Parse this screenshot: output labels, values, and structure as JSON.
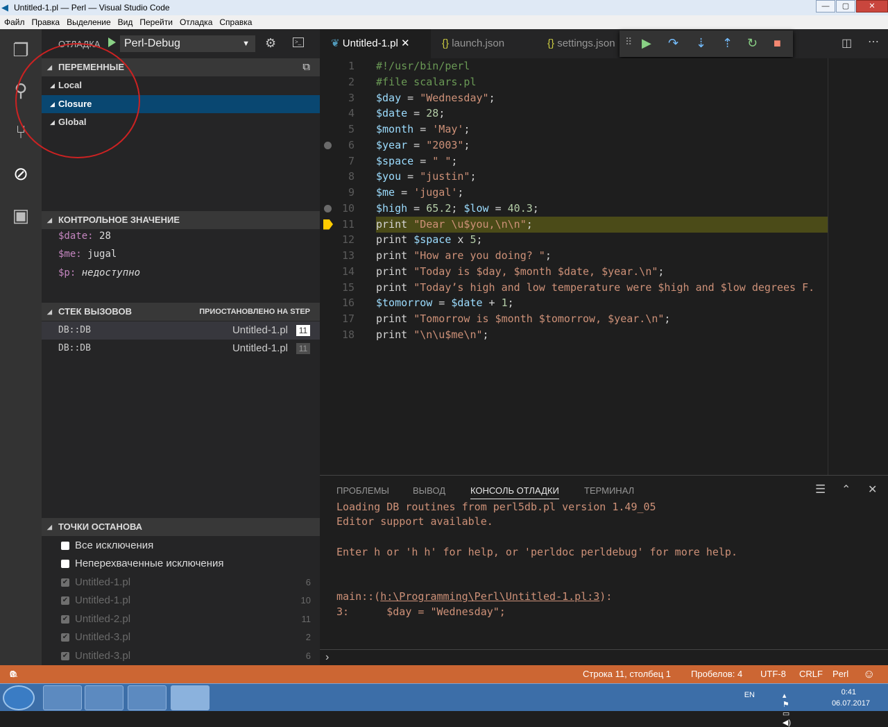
{
  "window": {
    "title": "Untitled-1.pl — Perl — Visual Studio Code",
    "min": "—",
    "max": "▢",
    "close": "✕"
  },
  "menu": [
    "Файл",
    "Правка",
    "Выделение",
    "Вид",
    "Перейти",
    "Отладка",
    "Справка"
  ],
  "debug": {
    "label": "ОТЛАДКА",
    "config": "Perl-Debug"
  },
  "variables": {
    "title": "ПЕРЕМЕННЫЕ",
    "scopes": [
      "Local",
      "Closure",
      "Global"
    ]
  },
  "watch": {
    "title": "КОНТРОЛЬНОЕ ЗНАЧЕНИЕ",
    "items": [
      {
        "name": "$date:",
        "value": "28"
      },
      {
        "name": "$me:",
        "value": "jugal"
      },
      {
        "name": "$p:",
        "value": "недоступно"
      }
    ]
  },
  "callstack": {
    "title": "СТЕК ВЫЗОВОВ",
    "status": "ПРИОСТАНОВЛЕНО НА STEP",
    "frames": [
      {
        "name": "DB::DB",
        "file": "Untitled-1.pl",
        "line": "11"
      },
      {
        "name": "DB::DB",
        "file": "Untitled-1.pl",
        "line": "11"
      }
    ]
  },
  "breakpoints": {
    "title": "ТОЧКИ ОСТАНОВА",
    "items": [
      {
        "label": "Все исключения",
        "line": ""
      },
      {
        "label": "Неперехваченные исключения",
        "line": ""
      },
      {
        "label": "Untitled-1.pl",
        "line": "6"
      },
      {
        "label": "Untitled-1.pl",
        "line": "10"
      },
      {
        "label": "Untitled-2.pl",
        "line": "11"
      },
      {
        "label": "Untitled-3.pl",
        "line": "2"
      },
      {
        "label": "Untitled-3.pl",
        "line": "6"
      }
    ]
  },
  "tabs": [
    {
      "label": "Untitled-1.pl",
      "close": "✕"
    },
    {
      "label": "launch.json"
    },
    {
      "label": "settings.json"
    }
  ],
  "code": [
    "#!/usr/bin/perl",
    "#file scalars.pl",
    "$day = \"Wednesday\";",
    "$date = 28;",
    "$month = 'May';",
    "$year = \"2003\";",
    "$space = \" \";",
    "$you = \"justin\";",
    "$me = 'jugal';",
    "$high = 65.2; $low = 40.3;",
    "print \"Dear \\u$you,\\n\\n\";",
    "print $space x 5;",
    "print \"How are you doing? \";",
    "print \"Today is $day, $month $date, $year.\\n\";",
    "print \"Today’s high and low temperature were $high and $low degrees F.",
    "$tomorrow = $date + 1;",
    "print \"Tomorrow is $month $tomorrow, $year.\\n\";",
    "print \"\\n\\u$me\\n\";"
  ],
  "panel": {
    "tabs": [
      "ПРОБЛЕМЫ",
      "ВЫВОД",
      "КОНСОЛЬ ОТЛАДКИ",
      "ТЕРМИНАЛ"
    ],
    "lines": [
      "Loading DB routines from perl5db.pl version 1.49_05",
      "Editor support available.",
      "",
      "Enter h or 'h h' for help, or 'perldoc perldebug' for more help.",
      "",
      "",
      ""
    ],
    "main_prefix": "main::(",
    "main_link": "h:\\Programming\\Perl\\Untitled-1.pl:3",
    "main_suffix": "):",
    "line3": "3:      $day = \"Wednesday\";",
    "prompt": "›"
  },
  "status": {
    "errors": "0",
    "warnings": "0",
    "position": "Строка 11, столбец 1",
    "spaces": "Пробелов: 4",
    "encoding": "UTF-8",
    "eol": "CRLF",
    "language": "Perl"
  },
  "tray": {
    "lang": "EN",
    "time": "0:41",
    "date": "06.07.2017"
  }
}
